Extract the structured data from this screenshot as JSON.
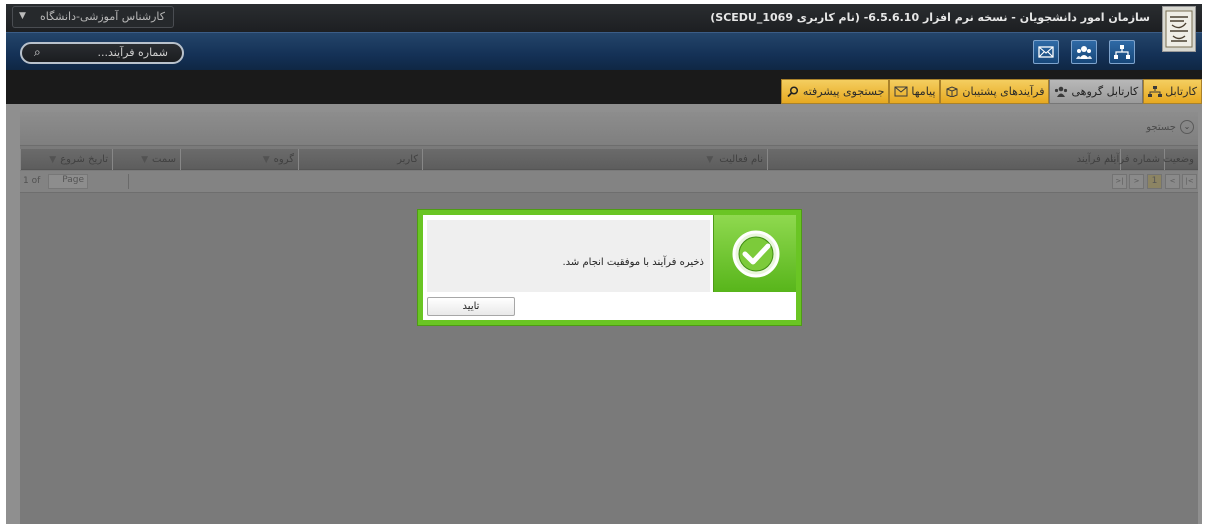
{
  "app": {
    "title": "سازمان امور دانشجویان - نسخه نرم افزار 6.5.6.10- (نام کاربری SCEDU_1069)",
    "role_selected": "کارشناس آموزشی-دانشگاه"
  },
  "toolbar": {
    "search_placeholder": "شماره فرآیند...",
    "buttons": [
      "org-chart",
      "group-users",
      "messages"
    ]
  },
  "tabs": [
    {
      "label": "کارتابل",
      "icon": "tree-icon",
      "active": false
    },
    {
      "label": "کارتابل گروهی",
      "icon": "group-icon",
      "active": true
    },
    {
      "label": "فرآیندهای پشتیبان",
      "icon": "box-icon",
      "active": false
    },
    {
      "label": "پیامها",
      "icon": "mail-icon",
      "active": false
    },
    {
      "label": "جستجوی پیشرفته",
      "icon": "search-icon",
      "active": false
    }
  ],
  "panel": {
    "search_label": "جستجو",
    "columns": {
      "status": "وضعیت",
      "process_no": "شماره فرآیند",
      "process_name": "نام فرآیند",
      "activity_name": "نام فعالیت",
      "user": "کاربر",
      "group": "گروه",
      "position": "سمت",
      "start_date": "تاریخ شروع"
    },
    "pager": {
      "page_label": "Page",
      "of_label": "1 of",
      "current_page": "1"
    }
  },
  "dialog": {
    "message": "ذخیره فرآیند با موفقیت انجام شد.",
    "ok_label": "تایید"
  },
  "colors": {
    "dialog_border": "#6ac524",
    "tab_active": "#9a9a9a",
    "tab": "#e7a920",
    "toolbar": "#143156"
  }
}
